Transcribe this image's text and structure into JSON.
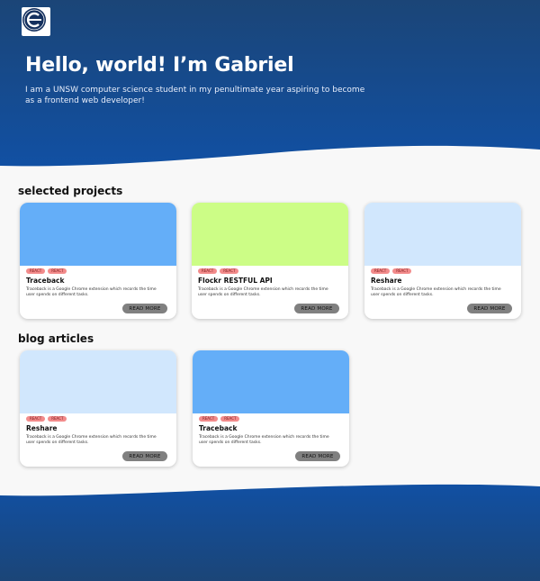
{
  "hero": {
    "title": "Hello, world! I’m Gabriel",
    "subtitle": "I am a UNSW computer science student in my penultimate year aspiring to become as a frontend web developer!"
  },
  "colors": {
    "hero_gradient_top": "#1b4577",
    "hero_gradient_bottom": "#1150a3",
    "page_background": "#f8f8f8",
    "tag_background": "#f28b8b",
    "button_background": "#808080"
  },
  "projects": {
    "heading": "selected projects",
    "cards": [
      {
        "image_color": "#64aef8",
        "tags": [
          "REACT",
          "REACT"
        ],
        "title": "Traceback",
        "description": "Traceback is a Google Chrome extension which records the time user spends on different tasks.",
        "button": "READ MORE"
      },
      {
        "image_color": "#ccfd86",
        "tags": [
          "REACT",
          "REACT"
        ],
        "title": "Flockr RESTFUL API",
        "description": "Traceback is a Google Chrome extension which records the time user spends on different tasks.",
        "button": "READ MORE"
      },
      {
        "image_color": "#d1e7fd",
        "tags": [
          "REACT",
          "REACT"
        ],
        "title": "Reshare",
        "description": "Traceback is a Google Chrome extension which records the time user spends on different tasks.",
        "button": "READ MORE"
      }
    ]
  },
  "blog": {
    "heading": "blog articles",
    "cards": [
      {
        "image_color": "#d1e7fd",
        "tags": [
          "REACT",
          "REACT"
        ],
        "title": "Reshare",
        "description": "Traceback is a Google Chrome extension which records the time user spends on different tasks.",
        "button": "READ MORE"
      },
      {
        "image_color": "#64aef8",
        "tags": [
          "REACT",
          "REACT"
        ],
        "title": "Traceback",
        "description": "Traceback is a Google Chrome extension which records the time user spends on different tasks.",
        "button": "READ MORE"
      }
    ]
  }
}
